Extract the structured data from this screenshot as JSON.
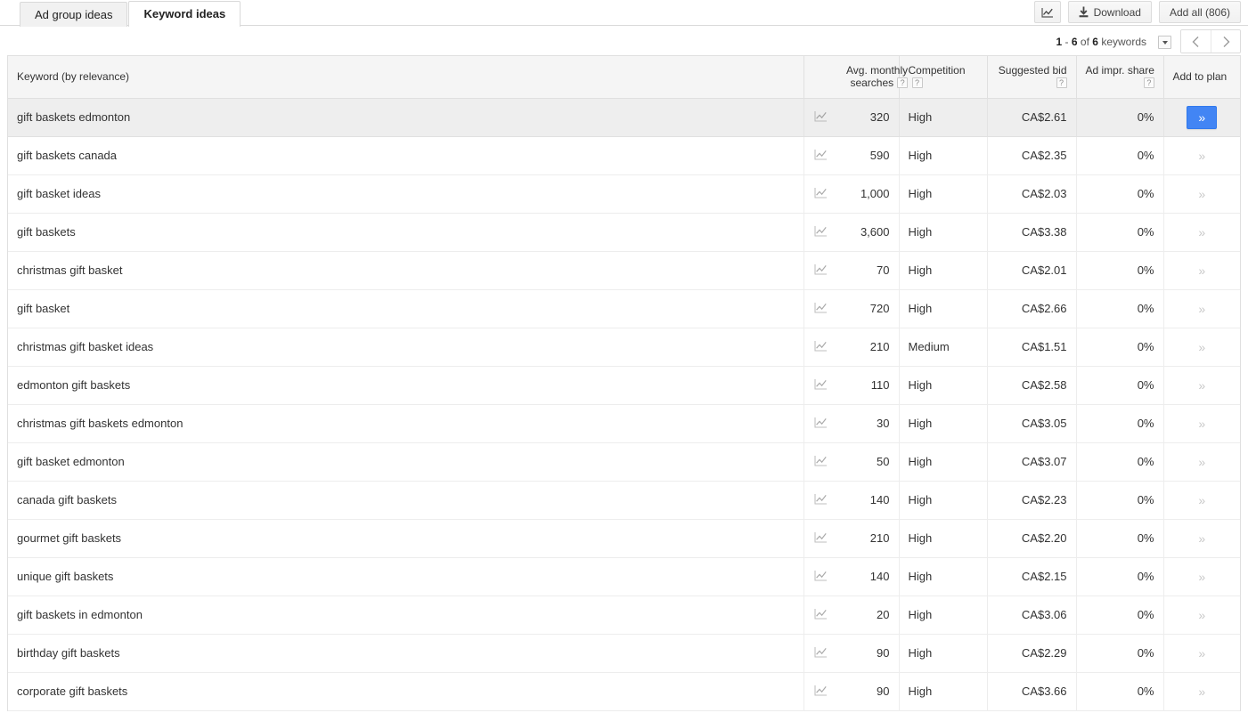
{
  "tabs": [
    {
      "label": "Ad group ideas",
      "active": false
    },
    {
      "label": "Keyword ideas",
      "active": true
    }
  ],
  "toolbar": {
    "chart_toggle_icon": "line-chart-icon",
    "download_label": "Download",
    "download_icon": "download-icon",
    "add_all_label": "Add all (806)"
  },
  "pagination": {
    "range_start": "1",
    "range_sep": "-",
    "range_end": "6",
    "of_text": "of",
    "total": "6",
    "unit": "keywords",
    "dropdown_icon": "chevron-down-icon",
    "prev_icon": "chevron-left-icon",
    "next_icon": "chevron-right-icon"
  },
  "table": {
    "headers": {
      "keyword": "Keyword (by relevance)",
      "spark": "",
      "avg_monthly_searches_l1": "Avg. monthly",
      "avg_monthly_searches_l2": "searches",
      "competition": "Competition",
      "suggested_bid": "Suggested bid",
      "ad_impr_share": "Ad impr. share",
      "add_to_plan": "Add to plan",
      "help_glyph": "?"
    },
    "add_button_glyph": "»",
    "rows": [
      {
        "keyword": "gift baskets edmonton",
        "searches": "320",
        "competition": "High",
        "bid": "CA$2.61",
        "impr": "0%",
        "selected": true
      },
      {
        "keyword": "gift baskets canada",
        "searches": "590",
        "competition": "High",
        "bid": "CA$2.35",
        "impr": "0%",
        "selected": false
      },
      {
        "keyword": "gift basket ideas",
        "searches": "1,000",
        "competition": "High",
        "bid": "CA$2.03",
        "impr": "0%",
        "selected": false
      },
      {
        "keyword": "gift baskets",
        "searches": "3,600",
        "competition": "High",
        "bid": "CA$3.38",
        "impr": "0%",
        "selected": false
      },
      {
        "keyword": "christmas gift basket",
        "searches": "70",
        "competition": "High",
        "bid": "CA$2.01",
        "impr": "0%",
        "selected": false
      },
      {
        "keyword": "gift basket",
        "searches": "720",
        "competition": "High",
        "bid": "CA$2.66",
        "impr": "0%",
        "selected": false
      },
      {
        "keyword": "christmas gift basket ideas",
        "searches": "210",
        "competition": "Medium",
        "bid": "CA$1.51",
        "impr": "0%",
        "selected": false
      },
      {
        "keyword": "edmonton gift baskets",
        "searches": "110",
        "competition": "High",
        "bid": "CA$2.58",
        "impr": "0%",
        "selected": false
      },
      {
        "keyword": "christmas gift baskets edmonton",
        "searches": "30",
        "competition": "High",
        "bid": "CA$3.05",
        "impr": "0%",
        "selected": false
      },
      {
        "keyword": "gift basket edmonton",
        "searches": "50",
        "competition": "High",
        "bid": "CA$3.07",
        "impr": "0%",
        "selected": false
      },
      {
        "keyword": "canada gift baskets",
        "searches": "140",
        "competition": "High",
        "bid": "CA$2.23",
        "impr": "0%",
        "selected": false
      },
      {
        "keyword": "gourmet gift baskets",
        "searches": "210",
        "competition": "High",
        "bid": "CA$2.20",
        "impr": "0%",
        "selected": false
      },
      {
        "keyword": "unique gift baskets",
        "searches": "140",
        "competition": "High",
        "bid": "CA$2.15",
        "impr": "0%",
        "selected": false
      },
      {
        "keyword": "gift baskets in edmonton",
        "searches": "20",
        "competition": "High",
        "bid": "CA$3.06",
        "impr": "0%",
        "selected": false
      },
      {
        "keyword": "birthday gift baskets",
        "searches": "90",
        "competition": "High",
        "bid": "CA$2.29",
        "impr": "0%",
        "selected": false
      },
      {
        "keyword": "corporate gift baskets",
        "searches": "90",
        "competition": "High",
        "bid": "CA$3.66",
        "impr": "0%",
        "selected": false
      }
    ],
    "row_icons": {
      "spark": "line-chart-icon"
    }
  },
  "colors": {
    "accent_blue": "#4285f4",
    "accent_blue_border": "#3079ed",
    "header_bg": "#f5f5f5",
    "selected_row_bg": "#eeeeee",
    "border": "#e0e0e0"
  }
}
